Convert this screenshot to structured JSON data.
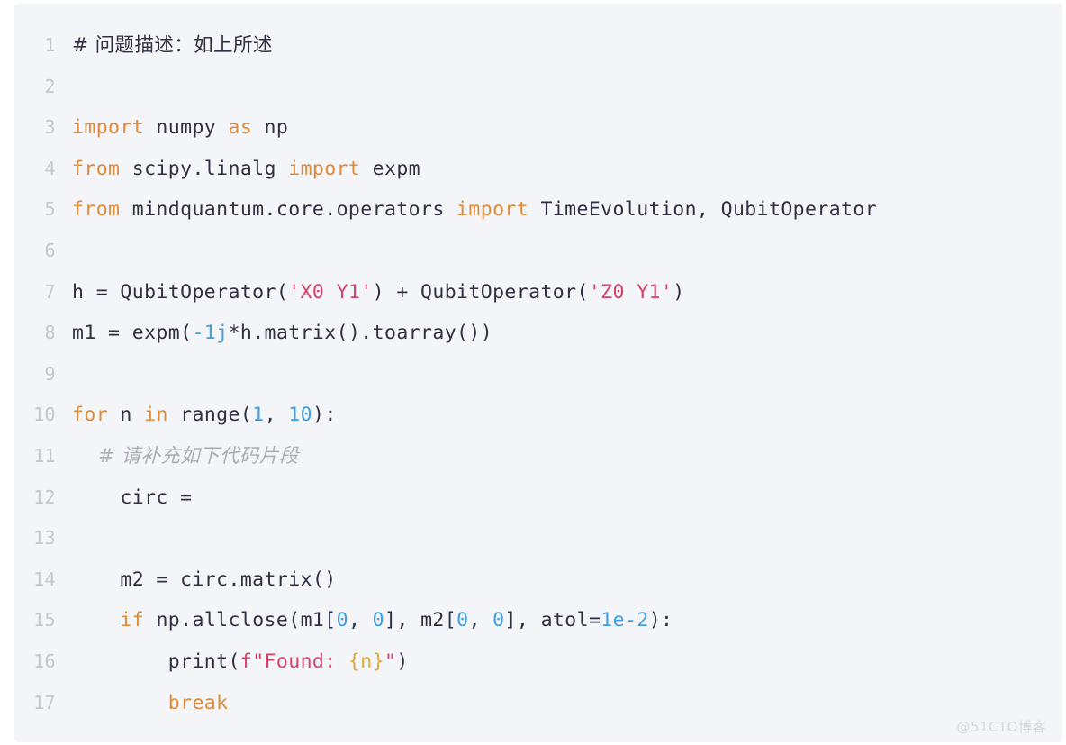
{
  "card": {
    "background_color": "#f4f5f8",
    "language": "python",
    "line_number_color": "#c3c7ce",
    "text_color": "#2e3141"
  },
  "theme": {
    "keyword_color": "#e08a38",
    "string_color": "#d6416a",
    "number_color": "#3f9fe0",
    "fstring_expr_color": "#e0a83a",
    "comment_dim_color": "#a9aeb8"
  },
  "watermark": {
    "text": "@51CTO博客"
  },
  "code": {
    "line_numbers": [
      "1",
      "2",
      "3",
      "4",
      "5",
      "6",
      "7",
      "8",
      "9",
      "10",
      "11",
      "12",
      "13",
      "14",
      "15",
      "16",
      "17"
    ],
    "lines": [
      {
        "n": "1",
        "text": "# 问题描述：如上所述"
      },
      {
        "n": "2",
        "text": ""
      },
      {
        "n": "3",
        "text": "import numpy as np"
      },
      {
        "n": "4",
        "text": "from scipy.linalg import expm"
      },
      {
        "n": "5",
        "text": "from mindquantum.core.operators import TimeEvolution, QubitOperator"
      },
      {
        "n": "6",
        "text": ""
      },
      {
        "n": "7",
        "text": "h = QubitOperator('X0 Y1') + QubitOperator('Z0 Y1')"
      },
      {
        "n": "8",
        "text": "m1 = expm(-1j*h.matrix().toarray())"
      },
      {
        "n": "9",
        "text": ""
      },
      {
        "n": "10",
        "text": "for n in range(1, 10):"
      },
      {
        "n": "11",
        "text": "    # 请补充如下代码片段"
      },
      {
        "n": "12",
        "text": "    circ = "
      },
      {
        "n": "13",
        "text": ""
      },
      {
        "n": "14",
        "text": "    m2 = circ.matrix()"
      },
      {
        "n": "15",
        "text": "    if np.allclose(m1[0, 0], m2[0, 0], atol=1e-2):"
      },
      {
        "n": "16",
        "text": "        print(f\"Found: {n}\")"
      },
      {
        "n": "17",
        "text": "        break"
      }
    ],
    "tokens": {
      "l1_comment": "# 问题描述：如上所述",
      "l3_kw_import": "import",
      "l3_module": " numpy ",
      "l3_kw_as": "as",
      "l3_alias": " np",
      "l4_kw_from": "from",
      "l4_module": " scipy.linalg ",
      "l4_kw_import": "import",
      "l4_name": " expm",
      "l5_kw_from": "from",
      "l5_module": " mindquantum.core.operators ",
      "l5_kw_import": "import",
      "l5_names": " TimeEvolution, QubitOperator",
      "l7_pre": "h = QubitOperator(",
      "l7_str1": "'X0 Y1'",
      "l7_mid": ") + QubitOperator(",
      "l7_str2": "'Z0 Y1'",
      "l7_post": ")",
      "l8_pre": "m1 = expm(",
      "l8_num": "-1j",
      "l8_post": "*h.matrix().toarray())",
      "l10_kw_for": "for",
      "l10_var": " n ",
      "l10_kw_in": "in",
      "l10_call": " range(",
      "l10_num1": "1",
      "l10_comma": ", ",
      "l10_num2": "10",
      "l10_end": "):",
      "l11_comment": "    # 请补充如下代码片段",
      "l12_text": "    circ = ",
      "l14_text": "    m2 = circ.matrix()",
      "l15_indent": "    ",
      "l15_kw_if": "if",
      "l15_a": " np.allclose(m1[",
      "l15_n1": "0",
      "l15_b": ", ",
      "l15_n2": "0",
      "l15_c": "], m2[",
      "l15_n3": "0",
      "l15_d": ", ",
      "l15_n4": "0",
      "l15_e": "], atol=",
      "l15_n5": "1e-2",
      "l15_f": "):",
      "l16_indent": "        ",
      "l16_pre": "print(",
      "l16_fprefix": "f\"Found: ",
      "l16_expr": "{n}",
      "l16_fsuffix": "\"",
      "l16_post": ")",
      "l17_indent": "        ",
      "l17_kw_break": "break"
    }
  }
}
